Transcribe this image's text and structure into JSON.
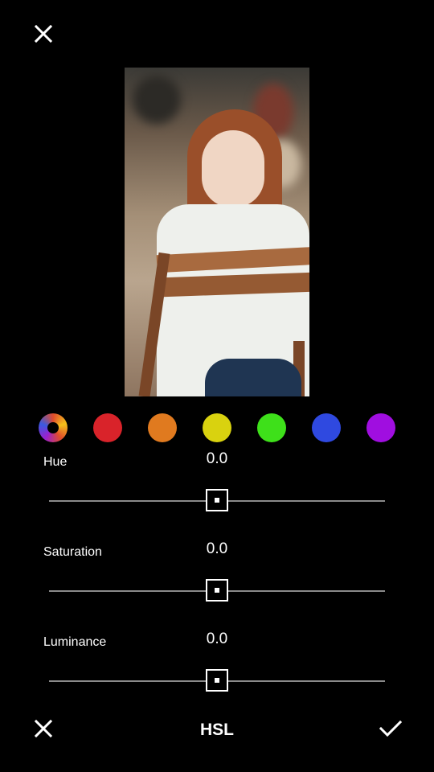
{
  "top_close": {
    "icon": "close-icon"
  },
  "swatches": [
    {
      "name": "all",
      "icon": "color-wheel-icon",
      "color": "conic"
    },
    {
      "name": "red",
      "color": "#d9232a"
    },
    {
      "name": "orange",
      "color": "#e07a1f"
    },
    {
      "name": "yellow",
      "color": "#d9d20f"
    },
    {
      "name": "green",
      "color": "#3ee01a"
    },
    {
      "name": "blue",
      "color": "#2f49e0"
    },
    {
      "name": "purple",
      "color": "#a00ee0"
    }
  ],
  "sliders": [
    {
      "label": "Hue",
      "value": "0.0",
      "level": 0.5
    },
    {
      "label": "Saturation",
      "value": "0.0",
      "level": 0.5
    },
    {
      "label": "Luminance",
      "value": "0.0",
      "level": 0.5
    }
  ],
  "bottom_bar": {
    "cancel_icon": "close-icon",
    "title": "HSL",
    "apply_icon": "checkmark-icon"
  }
}
